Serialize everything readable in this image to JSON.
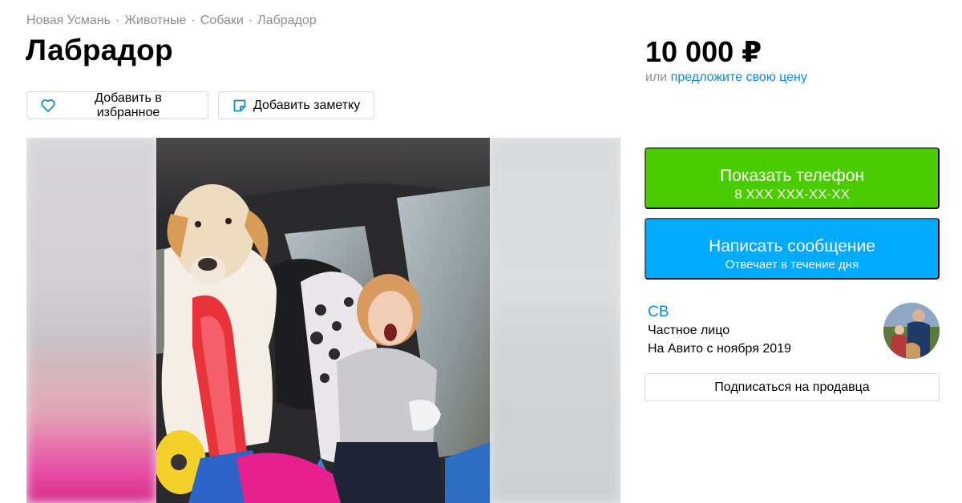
{
  "breadcrumb": [
    "Новая Усмань",
    "Животные",
    "Собаки",
    "Лабрадор"
  ],
  "breadcrumb_sep": "·",
  "title": "Лабрадор",
  "actions": {
    "favorite_label": "Добавить в избранное",
    "note_label": "Добавить заметку"
  },
  "price": {
    "value": "10 000 ₽",
    "offer_prefix": "или",
    "offer_link": "предложите свою цену"
  },
  "contact": {
    "phone_label": "Показать телефон",
    "phone_mask": "8 XXX XXX-XX-XX",
    "message_label": "Написать сообщение",
    "message_sub": "Отвечает в течение дня"
  },
  "seller": {
    "name": "СВ",
    "type": "Частное лицо",
    "since": "На Авито с ноября 2019",
    "subscribe_label": "Подписаться на продавца"
  },
  "colors": {
    "accent_link": "#0a8ddb",
    "phone_button": "#4bcc00",
    "message_button": "#00aaff"
  },
  "icons": {
    "favorite": "heart-icon",
    "note": "note-icon"
  }
}
